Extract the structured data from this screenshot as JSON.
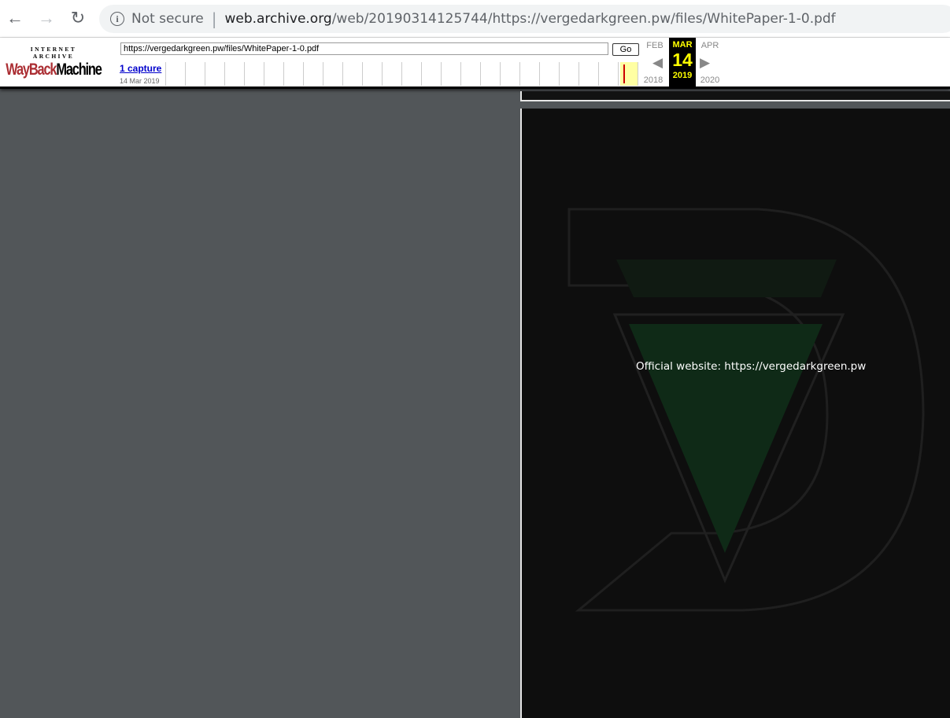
{
  "browser": {
    "security_label": "Not secure",
    "url_host": "web.archive.org",
    "url_path": "/web/20190314125744/https://vergedarkgreen.pw/files/WhitePaper-1-0.pdf",
    "icons": {
      "back": "back-arrow-icon",
      "forward": "forward-arrow-icon",
      "reload": "reload-icon",
      "info": "info-icon"
    }
  },
  "wayback": {
    "logo_top": "INTERNET ARCHIVE",
    "logo_way": "WayBack",
    "logo_machine": "Machine",
    "url_value": "https://vergedarkgreen.pw/files/WhitePaper-1-0.pdf",
    "go_label": "Go",
    "captures_label": "1 capture",
    "capture_date": "14 Mar 2019",
    "prev_month": "FEB",
    "current_month": "MAR",
    "next_month": "APR",
    "current_day": "14",
    "prev_year": "2018",
    "current_year": "2019",
    "next_year": "2020",
    "accent_color": "#ffff00",
    "logo_color": "#ab2e33"
  },
  "pdf": {
    "page_text": "Official website: https://vergedarkgreen.pw",
    "page_background": "#0e0e0e",
    "viewer_background": "#525659"
  }
}
